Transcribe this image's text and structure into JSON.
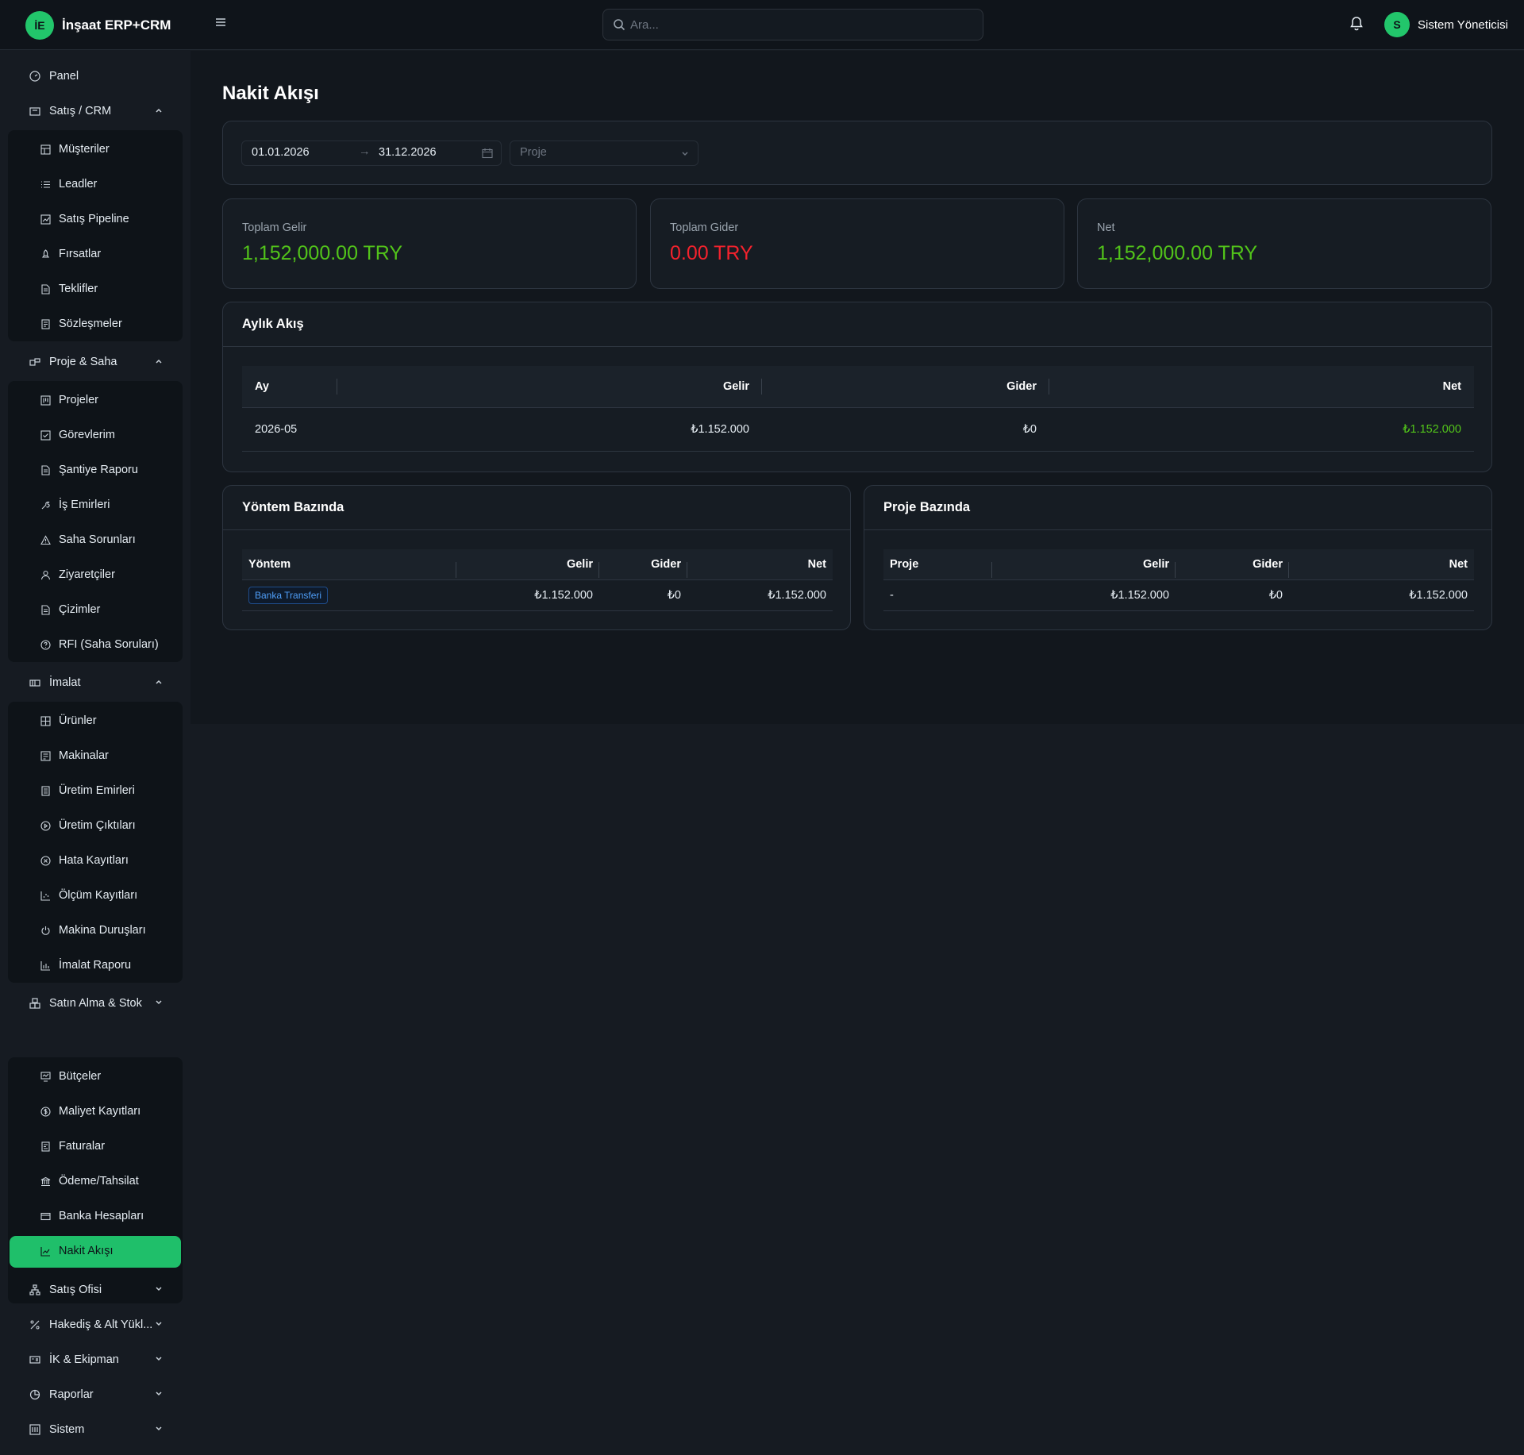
{
  "app": {
    "logo_text": "İE",
    "name": "İnşaat ERP+CRM"
  },
  "header": {
    "search_placeholder": "Ara...",
    "user_initial": "S",
    "user_name": "Sistem Yöneticisi"
  },
  "sidebar": {
    "panel": "Panel",
    "sales": {
      "label": "Satış / CRM",
      "items": [
        "Müşteriler",
        "Leadler",
        "Satış Pipeline",
        "Fırsatlar",
        "Teklifler",
        "Sözleşmeler"
      ]
    },
    "project": {
      "label": "Proje & Saha",
      "items": [
        "Projeler",
        "Görevlerim",
        "Şantiye Raporu",
        "İş Emirleri",
        "Saha Sorunları",
        "Ziyaretçiler",
        "Çizimler",
        "RFI (Saha Soruları)"
      ]
    },
    "manufacturing": {
      "label": "İmalat",
      "items": [
        "Ürünler",
        "Makinalar",
        "Üretim Emirleri",
        "Üretim Çıktıları",
        "Hata Kayıtları",
        "Ölçüm Kayıtları",
        "Makina Duruşları",
        "İmalat Raporu"
      ]
    },
    "purchase": {
      "label": "Satın Alma & Stok"
    },
    "finance": {
      "items": [
        "Bütçeler",
        "Maliyet Kayıtları",
        "Faturalar",
        "Ödeme/Tahsilat",
        "Banka Hesapları",
        "Nakit Akışı"
      ]
    },
    "sales_office": "Satış Ofisi",
    "progress": "Hakediş & Alt Yükl...",
    "hr": "İK & Ekipman",
    "reports": "Raporlar",
    "system": "Sistem"
  },
  "page": {
    "title": "Nakit Akışı"
  },
  "filters": {
    "date_start": "01.01.2026",
    "date_end": "31.12.2026",
    "date_separator": "→",
    "project_placeholder": "Proje"
  },
  "stats": [
    {
      "label": "Toplam Gelir",
      "value": "1,152,000.00 TRY",
      "color": "#52c41a"
    },
    {
      "label": "Toplam Gider",
      "value": "0.00 TRY",
      "color": "#f5222d"
    },
    {
      "label": "Net",
      "value": "1,152,000.00 TRY",
      "color": "#52c41a"
    }
  ],
  "monthly": {
    "title": "Aylık Akış",
    "columns": [
      "Ay",
      "Gelir",
      "Gider",
      "Net"
    ],
    "rows": [
      {
        "month": "2026-05",
        "income": "₺1.152.000",
        "expense": "₺0",
        "net": "₺1.152.000"
      }
    ]
  },
  "by_method": {
    "title": "Yöntem Bazında",
    "columns": [
      "Yöntem",
      "Gelir",
      "Gider",
      "Net"
    ],
    "rows": [
      {
        "method": "Banka Transferi",
        "income": "₺1.152.000",
        "expense": "₺0",
        "net": "₺1.152.000"
      }
    ]
  },
  "by_project": {
    "title": "Proje Bazında",
    "columns": [
      "Proje",
      "Gelir",
      "Gider",
      "Net"
    ],
    "rows": [
      {
        "project": "-",
        "income": "₺1.152.000",
        "expense": "₺0",
        "net": "₺1.152.000"
      }
    ]
  }
}
